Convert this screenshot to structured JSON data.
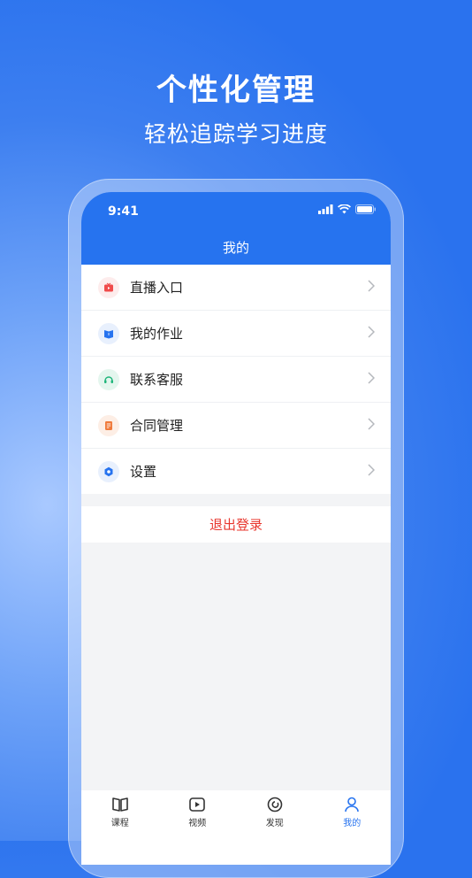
{
  "promo": {
    "headline": "个性化管理",
    "subline": "轻松追踪学习进度"
  },
  "status_bar": {
    "time": "9:41"
  },
  "nav": {
    "title": "我的"
  },
  "menu": {
    "items": [
      {
        "label": "直播入口",
        "icon": "live-tv-icon",
        "color": "#f04a4a",
        "bg": "#fdecec"
      },
      {
        "label": "我的作业",
        "icon": "book-icon",
        "color": "#2673ef",
        "bg": "#e8f0fd"
      },
      {
        "label": "联系客服",
        "icon": "headset-icon",
        "color": "#1fb57a",
        "bg": "#e4f6ee"
      },
      {
        "label": "合同管理",
        "icon": "contract-icon",
        "color": "#f07a3a",
        "bg": "#fdeee5"
      },
      {
        "label": "设置",
        "icon": "gear-icon",
        "color": "#2673ef",
        "bg": "#e8f0fd"
      }
    ]
  },
  "logout": {
    "label": "退出登录",
    "color": "#e8372e"
  },
  "tabbar": {
    "tabs": [
      {
        "label": "课程",
        "icon": "course-book-icon"
      },
      {
        "label": "视频",
        "icon": "video-play-icon"
      },
      {
        "label": "发现",
        "icon": "discover-icon"
      },
      {
        "label": "我的",
        "icon": "profile-icon",
        "active": true
      }
    ]
  },
  "colors": {
    "brand": "#2673ef",
    "background": "#f3f4f6"
  }
}
